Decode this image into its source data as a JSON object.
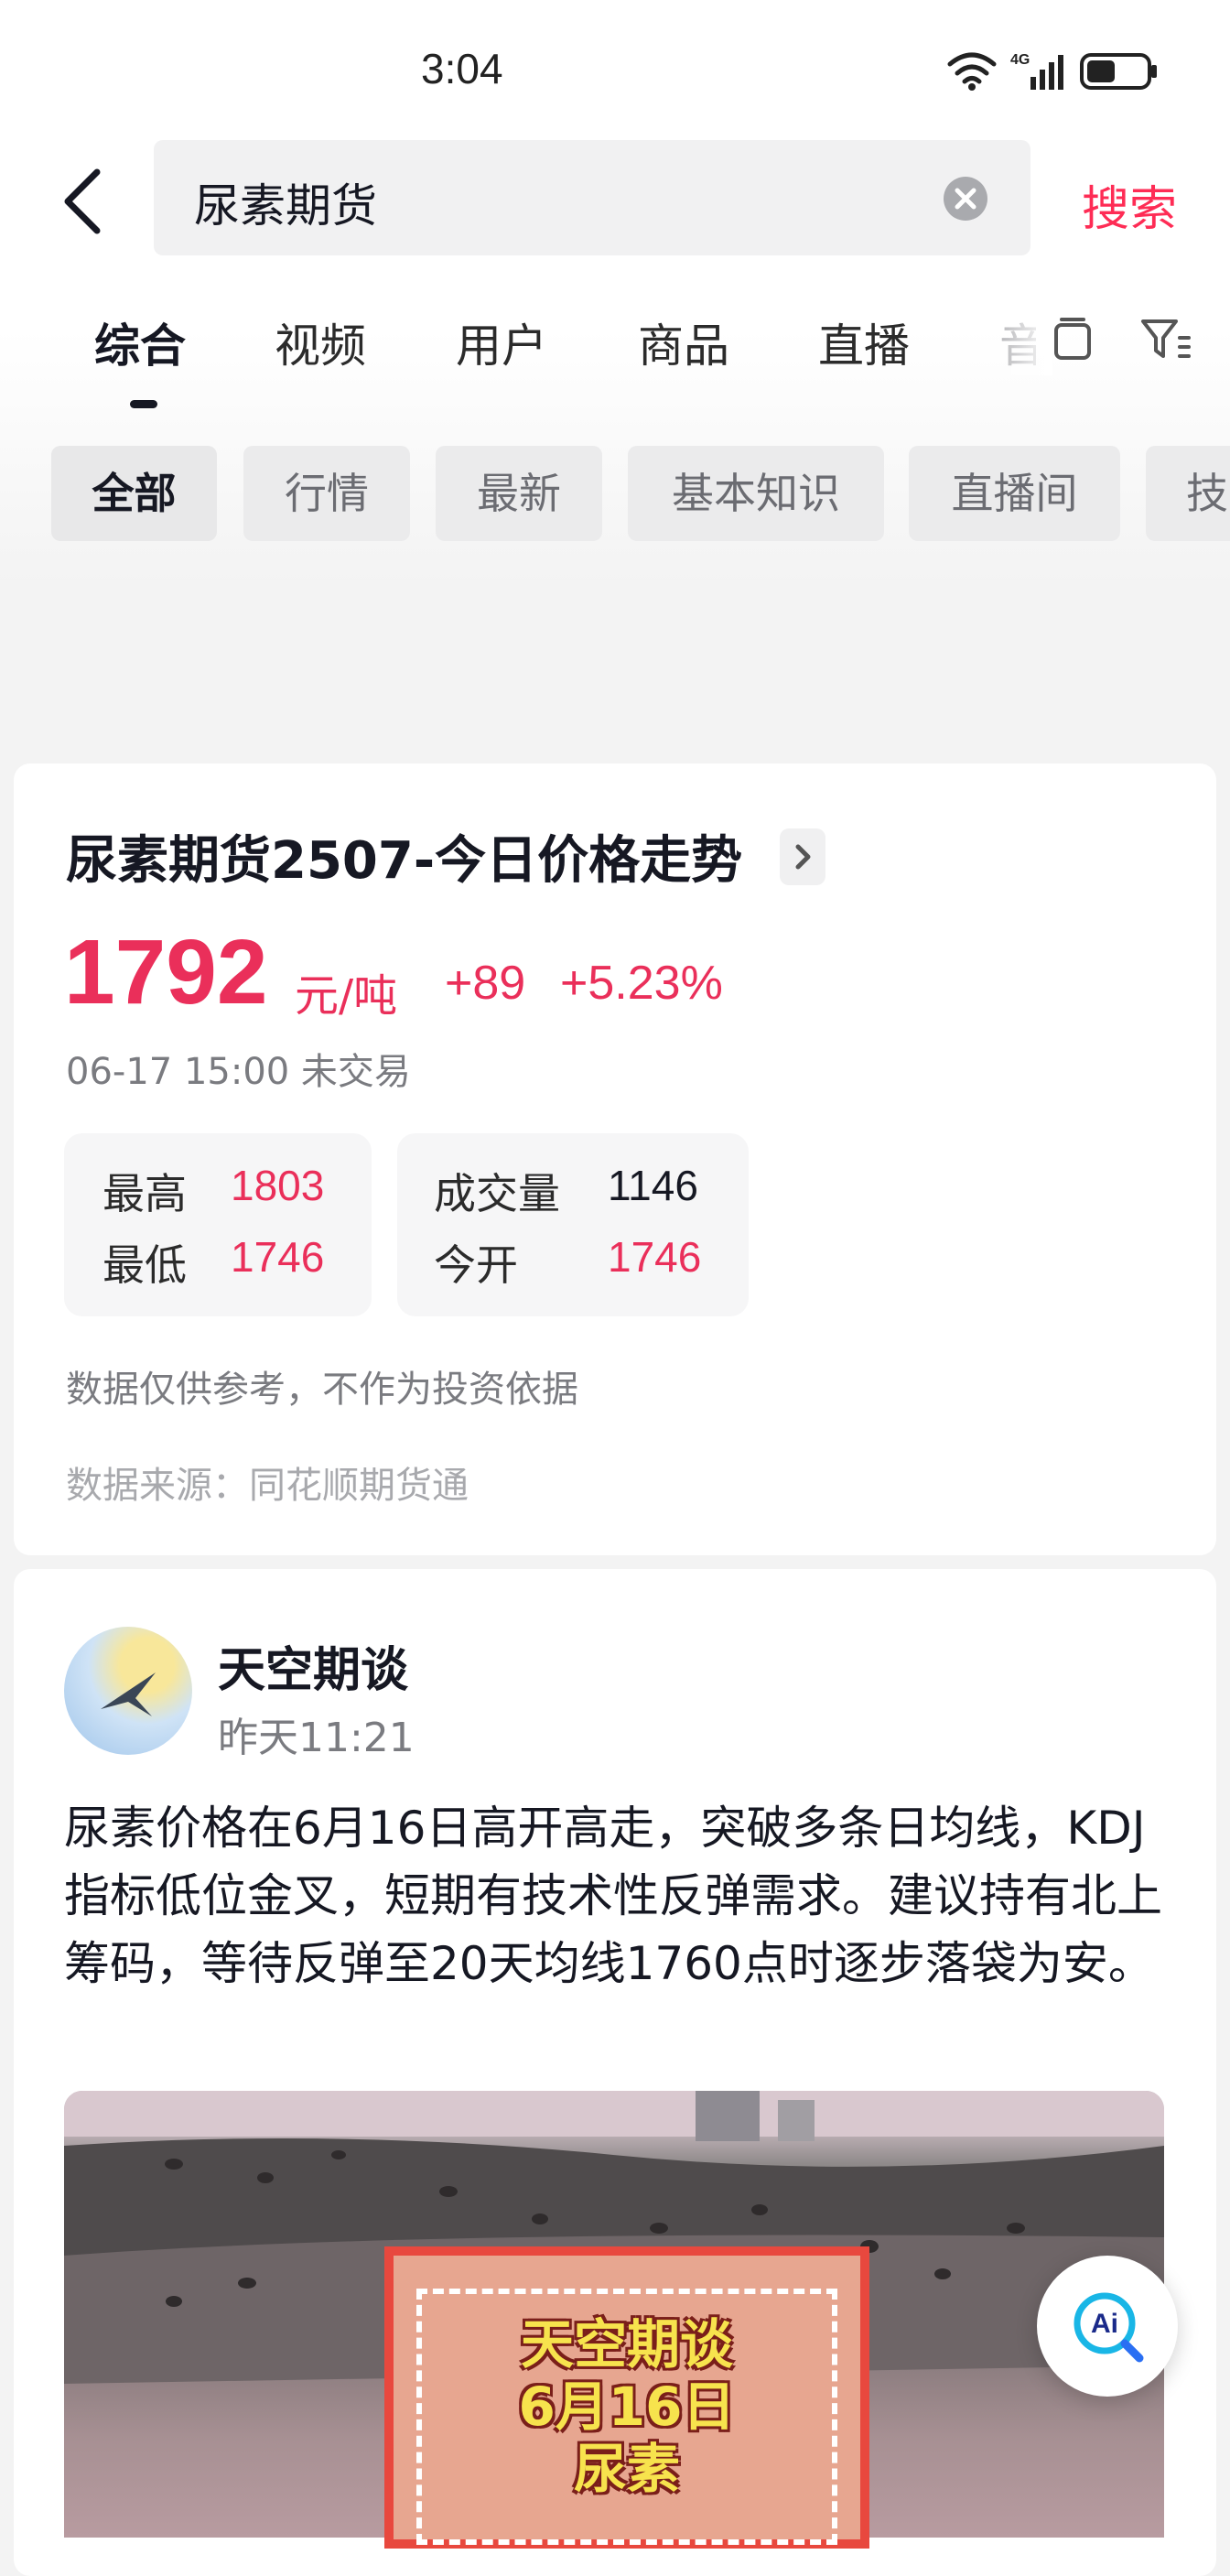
{
  "status_bar": {
    "time": "3:04",
    "network": "4G"
  },
  "search": {
    "query": "尿素期货",
    "submit_label": "搜索"
  },
  "tabs": [
    {
      "label": "综合",
      "active": true
    },
    {
      "label": "视频"
    },
    {
      "label": "用户"
    },
    {
      "label": "商品"
    },
    {
      "label": "直播"
    },
    {
      "label": "音"
    }
  ],
  "filters": [
    {
      "label": "全部",
      "active": true
    },
    {
      "label": "行情"
    },
    {
      "label": "最新"
    },
    {
      "label": "基本知识"
    },
    {
      "label": "直播间"
    },
    {
      "label": "技"
    }
  ],
  "quote": {
    "title": "尿素期货2507-今日价格走势",
    "price": "1792",
    "unit": "元/吨",
    "change": "+89",
    "change_pct": "+5.23%",
    "time": "06-17 15:00 未交易",
    "high_label": "最高",
    "high": "1803",
    "low_label": "最低",
    "low": "1746",
    "volume_label": "成交量",
    "volume": "1146",
    "open_label": "今开",
    "open": "1746",
    "disclaimer": "数据仅供参考，不作为投资依据",
    "source": "数据来源：同花顺期货通"
  },
  "post": {
    "author": "天空期谈",
    "time": "昨天11:21",
    "text": "尿素价格在6月16日高开高走，突破多条日均线，KDJ指标低位金叉，短期有技术性反弹需求。建议持有北上筹码，等待反弹至20天均线1760点时逐步落袋为安。",
    "image_lines": [
      "天空期谈",
      "6月16日",
      "尿素"
    ]
  },
  "colors": {
    "accent": "#fe2c55",
    "price_up": "#ea2f5a"
  },
  "icons": [
    "back-arrow-icon",
    "clear-icon",
    "copy-icon",
    "filter-icon",
    "chevron-right-icon",
    "ai-search-icon"
  ]
}
